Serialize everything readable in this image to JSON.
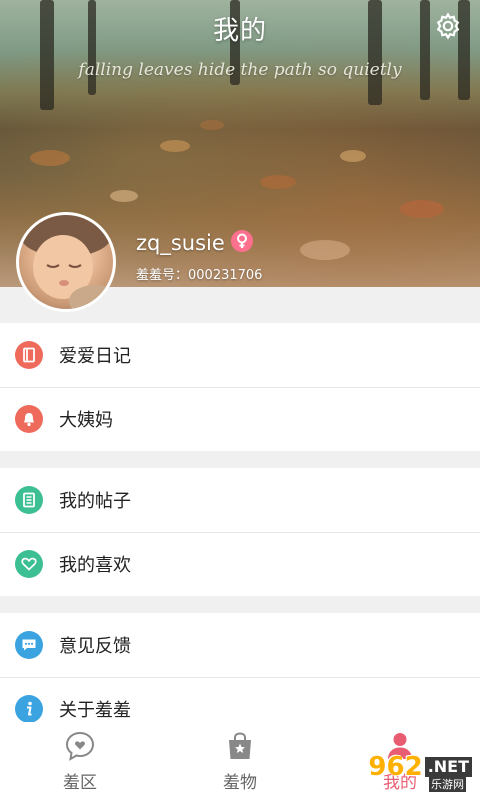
{
  "header": {
    "title": "我的",
    "tagline": "falling leaves hide the path so quietly",
    "username": "zq_susie",
    "uid_text": "羞羞号：000231706",
    "gender": "female"
  },
  "menu": {
    "group1": [
      {
        "label": "爱爱日记",
        "icon": "diary-icon",
        "color": "#ee6a5a"
      },
      {
        "label": "大姨妈",
        "icon": "bell-icon",
        "color": "#ee6a5a"
      }
    ],
    "group2": [
      {
        "label": "我的帖子",
        "icon": "posts-icon",
        "color": "#3dbf94"
      },
      {
        "label": "我的喜欢",
        "icon": "heart-icon",
        "color": "#3dbf94"
      }
    ],
    "group3": [
      {
        "label": "意见反馈",
        "icon": "feedback-icon",
        "color": "#3aa3e0"
      },
      {
        "label": "关于羞羞",
        "icon": "info-icon",
        "color": "#3aa3e0"
      }
    ]
  },
  "tabbar": {
    "tabs": [
      {
        "label": "羞区",
        "icon": "chat-heart-icon",
        "active": false
      },
      {
        "label": "羞物",
        "icon": "shopping-bag-icon",
        "active": false
      },
      {
        "label": "我的",
        "icon": "profile-icon",
        "active": true
      }
    ]
  },
  "watermark": {
    "number": "962",
    "suffix": ".NET",
    "site": "乐游网"
  },
  "colors": {
    "accent": "#e95d72",
    "red": "#ee6a5a",
    "green": "#3dbf94",
    "blue": "#3aa3e0"
  }
}
